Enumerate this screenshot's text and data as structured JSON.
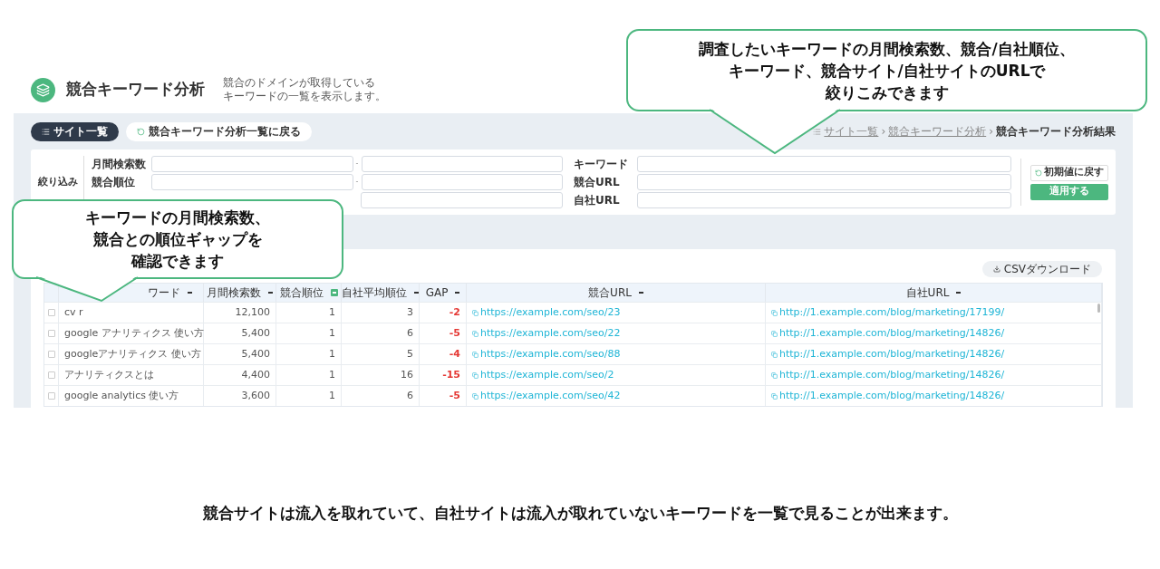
{
  "header": {
    "title": "競合キーワード分析",
    "description": [
      "競合のドメインが取得している",
      "キーワードの一覧を表示します。"
    ]
  },
  "toolbar": {
    "buttons": [
      {
        "label": "サイト一覧",
        "kind": "dark"
      },
      {
        "label": "競合キーワード分析一覧に戻る",
        "kind": "light"
      }
    ],
    "breadcrumb": [
      {
        "label": "サイト一覧",
        "current": false
      },
      {
        "label": "競合キーワード分析",
        "current": false
      },
      {
        "label": "競合キーワード分析結果",
        "current": true
      }
    ],
    "breadcrumb_separator": "›"
  },
  "filter": {
    "title": "絞り込み",
    "range_separator": "-",
    "ranges": [
      {
        "label": "月間検索数",
        "covered": false
      },
      {
        "label": "競合順位",
        "covered": false
      },
      {
        "covered": true
      }
    ],
    "text_fields": [
      {
        "label": "キーワード"
      },
      {
        "label": "競合URL"
      },
      {
        "label": "自社URL"
      }
    ],
    "reset_button": "初期値に戻す",
    "apply_button": "適用する"
  },
  "table": {
    "csv_button": "CSVダウンロード",
    "columns": [
      {
        "label": "ワード",
        "sorted": false
      },
      {
        "label": "月間検索数",
        "sorted": false
      },
      {
        "label": "競合順位",
        "sorted": true
      },
      {
        "label": "自社平均順位",
        "sorted": false
      },
      {
        "label": "GAP",
        "sorted": false
      },
      {
        "label": "競合URL",
        "sorted": false
      },
      {
        "label": "自社URL",
        "sorted": false
      }
    ],
    "rows": [
      {
        "checked": false,
        "cells": [
          "cv r",
          "12,100",
          "1",
          "3",
          "-2",
          "https://example.com/seo/23",
          "http://1.example.com/blog/marketing/17199/"
        ]
      },
      {
        "checked": false,
        "cells": [
          "google アナリティクス 使い方",
          "5,400",
          "1",
          "6",
          "-5",
          "https://example.com/seo/22",
          "http://1.example.com/blog/marketing/14826/"
        ]
      },
      {
        "checked": false,
        "cells": [
          "googleアナリティクス 使い方",
          "5,400",
          "1",
          "5",
          "-4",
          "https://example.com/seo/88",
          "http://1.example.com/blog/marketing/14826/"
        ]
      },
      {
        "checked": false,
        "cells": [
          "アナリティクスとは",
          "4,400",
          "1",
          "16",
          "-15",
          "https://example.com/seo/2",
          "http://1.example.com/blog/marketing/14826/"
        ]
      },
      {
        "checked": false,
        "cells": [
          "google analytics 使い方",
          "3,600",
          "1",
          "6",
          "-5",
          "https://example.com/seo/42",
          "http://1.example.com/blog/marketing/14826/"
        ]
      }
    ]
  },
  "callouts": [
    {
      "lines": [
        "調査したいキーワードの月間検索数、競合/自社順位、",
        "キーワード、競合サイト/自社サイトのURLで",
        "絞りこみできます"
      ]
    },
    {
      "lines": [
        "キーワードの月間検索数、",
        "競合との順位ギャップを",
        "確認できます"
      ]
    }
  ],
  "caption": "競合サイトは流入を取れていて、自社サイトは流入が取れていないキーワードを一覧で見ることが出来ます。"
}
